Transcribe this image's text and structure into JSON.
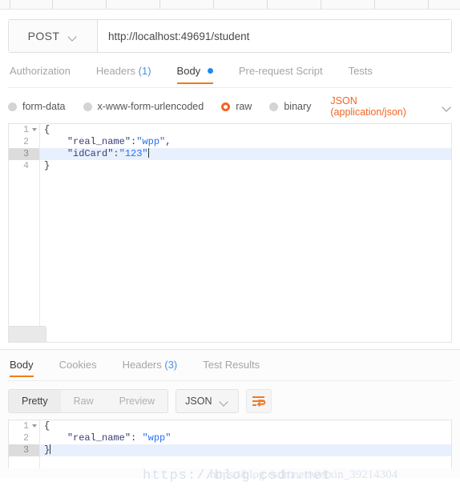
{
  "request": {
    "method": "POST",
    "url": "http://localhost:49691/student",
    "tabs": [
      {
        "label": "Authorization",
        "active": false
      },
      {
        "label": "Headers",
        "count": "(1)",
        "active": false
      },
      {
        "label": "Body",
        "active": true,
        "dot": true
      },
      {
        "label": "Pre-request Script",
        "active": false
      },
      {
        "label": "Tests",
        "active": false
      }
    ],
    "body_types": [
      {
        "label": "form-data",
        "selected": false
      },
      {
        "label": "x-www-form-urlencoded",
        "selected": false
      },
      {
        "label": "raw",
        "selected": true
      },
      {
        "label": "binary",
        "selected": false
      }
    ],
    "content_type": "JSON (application/json)",
    "editor": {
      "lines": [
        {
          "num": "1",
          "fold": true,
          "active": false,
          "indent": "",
          "text": "{"
        },
        {
          "num": "2",
          "fold": false,
          "active": false,
          "indent": "    ",
          "key": "\"real_name\"",
          "colon": ":",
          "value": "\"wpp\"",
          "trail": ","
        },
        {
          "num": "3",
          "fold": false,
          "active": true,
          "indent": "    ",
          "key": "\"idCard\"",
          "colon": ":",
          "value": "\"123\"",
          "trail": "",
          "caret": true
        },
        {
          "num": "4",
          "fold": false,
          "active": false,
          "indent": "",
          "text": "}"
        }
      ]
    }
  },
  "response": {
    "tabs": [
      {
        "label": "Body",
        "active": true
      },
      {
        "label": "Cookies",
        "active": false
      },
      {
        "label": "Headers",
        "count": "(3)",
        "active": false
      },
      {
        "label": "Test Results",
        "active": false
      }
    ],
    "view_modes": [
      {
        "label": "Pretty",
        "active": true
      },
      {
        "label": "Raw",
        "active": false
      },
      {
        "label": "Preview",
        "active": false
      }
    ],
    "format": "JSON",
    "wrap_icon": "word-wrap-icon",
    "editor": {
      "lines": [
        {
          "num": "1",
          "fold": true,
          "active": false,
          "indent": "",
          "text": "{"
        },
        {
          "num": "2",
          "fold": false,
          "active": false,
          "indent": "    ",
          "key": "\"real_name\"",
          "colon": ": ",
          "value": "\"wpp\"",
          "trail": ""
        },
        {
          "num": "3",
          "fold": false,
          "active": true,
          "indent": "",
          "text": "}",
          "caret": true
        }
      ]
    }
  },
  "watermark": {
    "line1": "https://blog.csdn.net",
    "line2": "https://blog.csdn.net/weixin_39214304"
  },
  "colors": {
    "accent_orange": "#f26522",
    "tab_underline": "#ef7c1b",
    "link_blue": "#4a90e2",
    "dot_blue": "#1f8cec",
    "json_key": "#3b3b7a",
    "json_value": "#2a6ff0",
    "active_line": "#e8f0fd"
  }
}
